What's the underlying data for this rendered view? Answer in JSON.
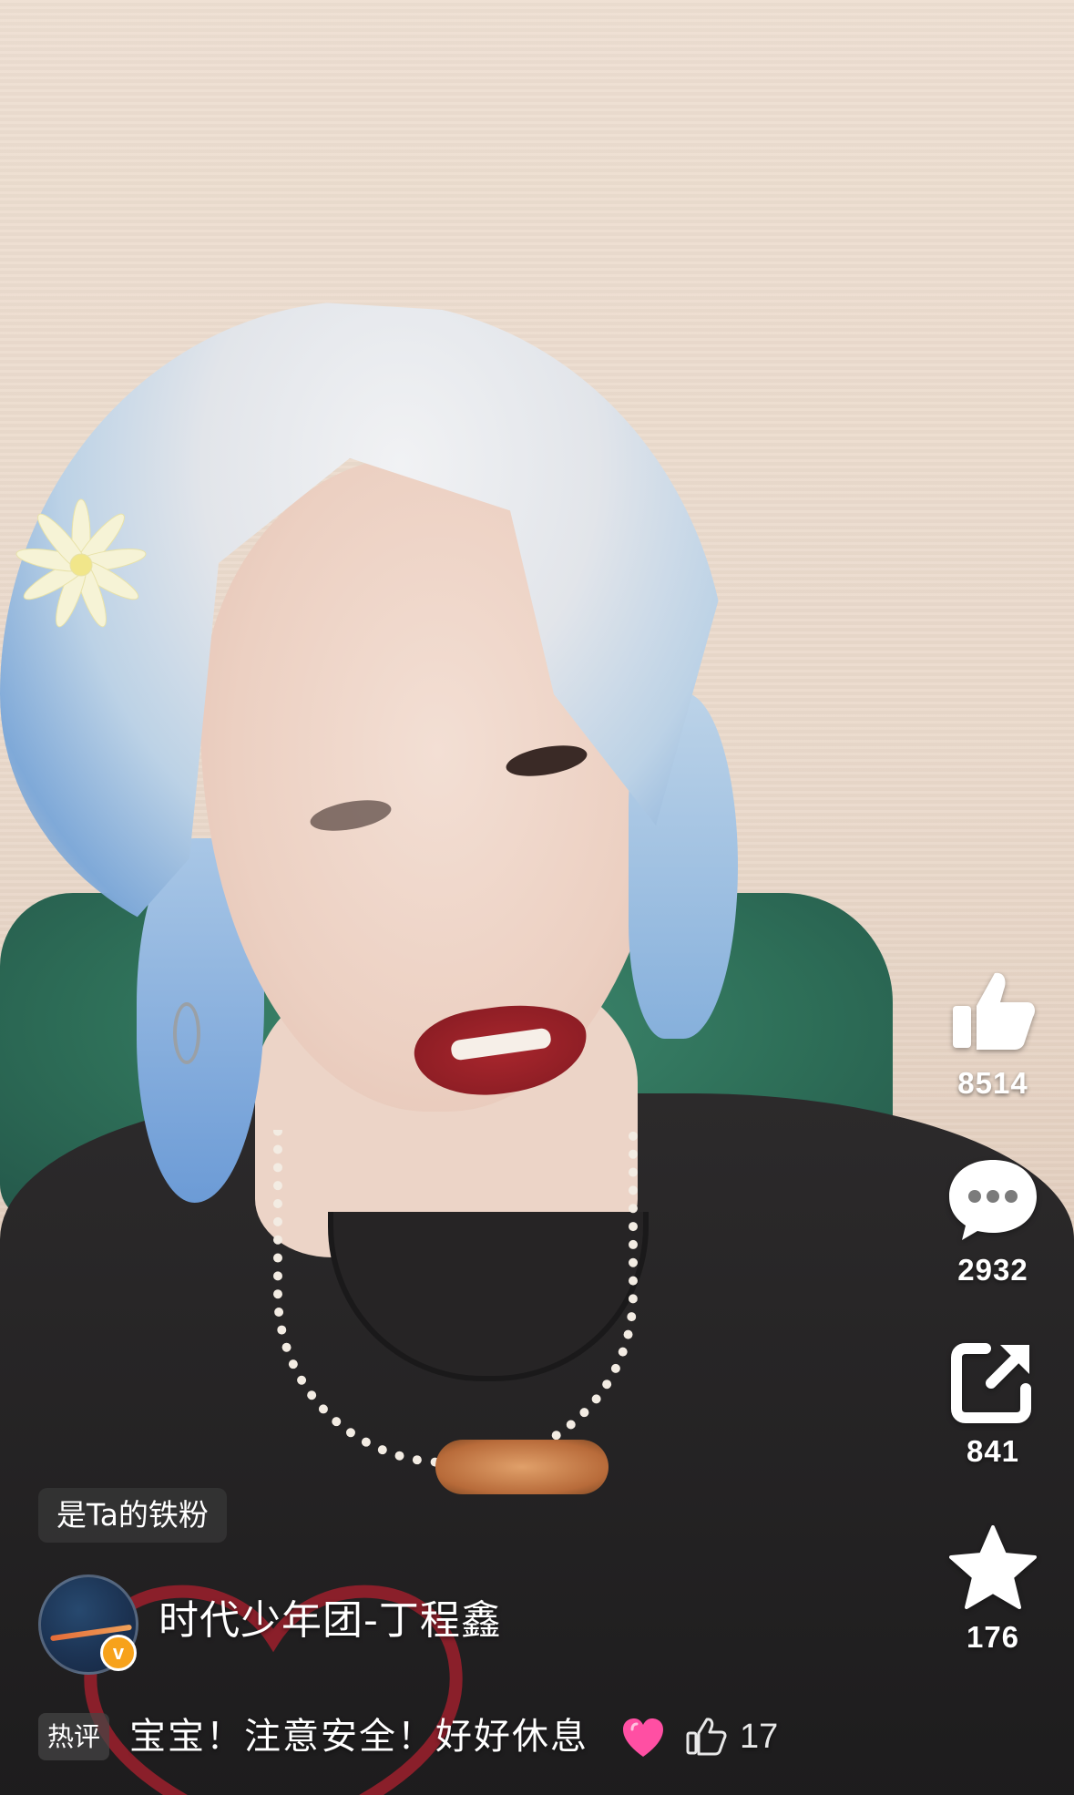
{
  "actions": {
    "like": {
      "icon": "thumbs-up-icon",
      "count": "8514"
    },
    "comment": {
      "icon": "comment-bubble-icon",
      "count": "2932"
    },
    "share": {
      "icon": "share-icon",
      "count": "841"
    },
    "favorite": {
      "icon": "star-icon",
      "count": "176"
    }
  },
  "fan_badge": {
    "label": "是Ta的铁粉"
  },
  "author": {
    "name": "时代少年团-丁程鑫",
    "verified_badge": "v"
  },
  "hot_comment": {
    "tag": "热评",
    "text": "宝宝！注意安全！好好休息",
    "emoji": "pink-heart-icon",
    "like_count": "17"
  },
  "colors": {
    "verified": "#f7a21b",
    "sofa": "#2e6f58",
    "lips": "#8f1e25",
    "heart": "#ff4fa3"
  }
}
